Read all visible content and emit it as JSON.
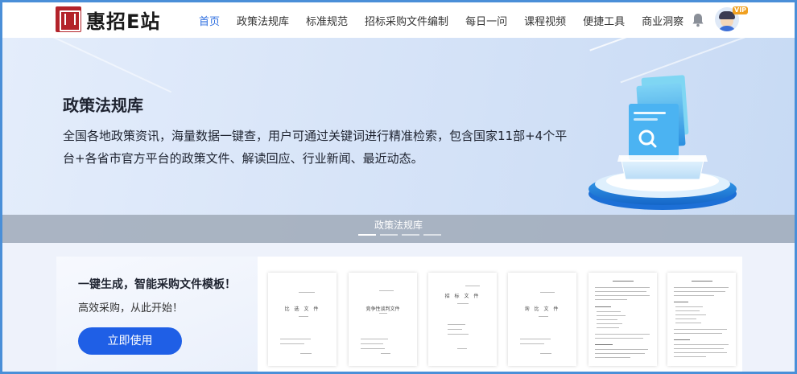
{
  "header": {
    "logo_text": "惠招E站",
    "nav": [
      {
        "label": "首页",
        "active": true
      },
      {
        "label": "政策法规库",
        "active": false
      },
      {
        "label": "标准规范",
        "active": false
      },
      {
        "label": "招标采购文件编制",
        "active": false
      },
      {
        "label": "每日一问",
        "active": false
      },
      {
        "label": "课程视频",
        "active": false
      },
      {
        "label": "便捷工具",
        "active": false
      },
      {
        "label": "商业洞察",
        "active": false
      }
    ],
    "icons": {
      "bell": "bell-icon",
      "avatar": "user-avatar"
    },
    "vip_badge": "VIP"
  },
  "banner": {
    "title": "政策法规库",
    "description": "全国各地政策资讯，海量数据一键查，用户可通过关键词进行精准检索，包含国家11部+4个平台+各省市官方平台的政策文件、解读回应、行业新闻、最近动态。",
    "caption": "政策法规库",
    "carousel_slides": 4,
    "active_slide": 0
  },
  "promo": {
    "title": "一键生成，智能采购文件模板！",
    "subtitle": "高效采购，从此开始！",
    "button_label": "立即使用",
    "doc_titles": [
      "比 选 文 件",
      "竞争性谈判文件",
      "招 标 文 件",
      "询 比 文 件",
      "",
      ""
    ]
  },
  "colors": {
    "accent": "#2f6fe0",
    "button": "#1f5fe6",
    "logo_red": "#b3232a",
    "frame_border": "#4a8fd8"
  }
}
